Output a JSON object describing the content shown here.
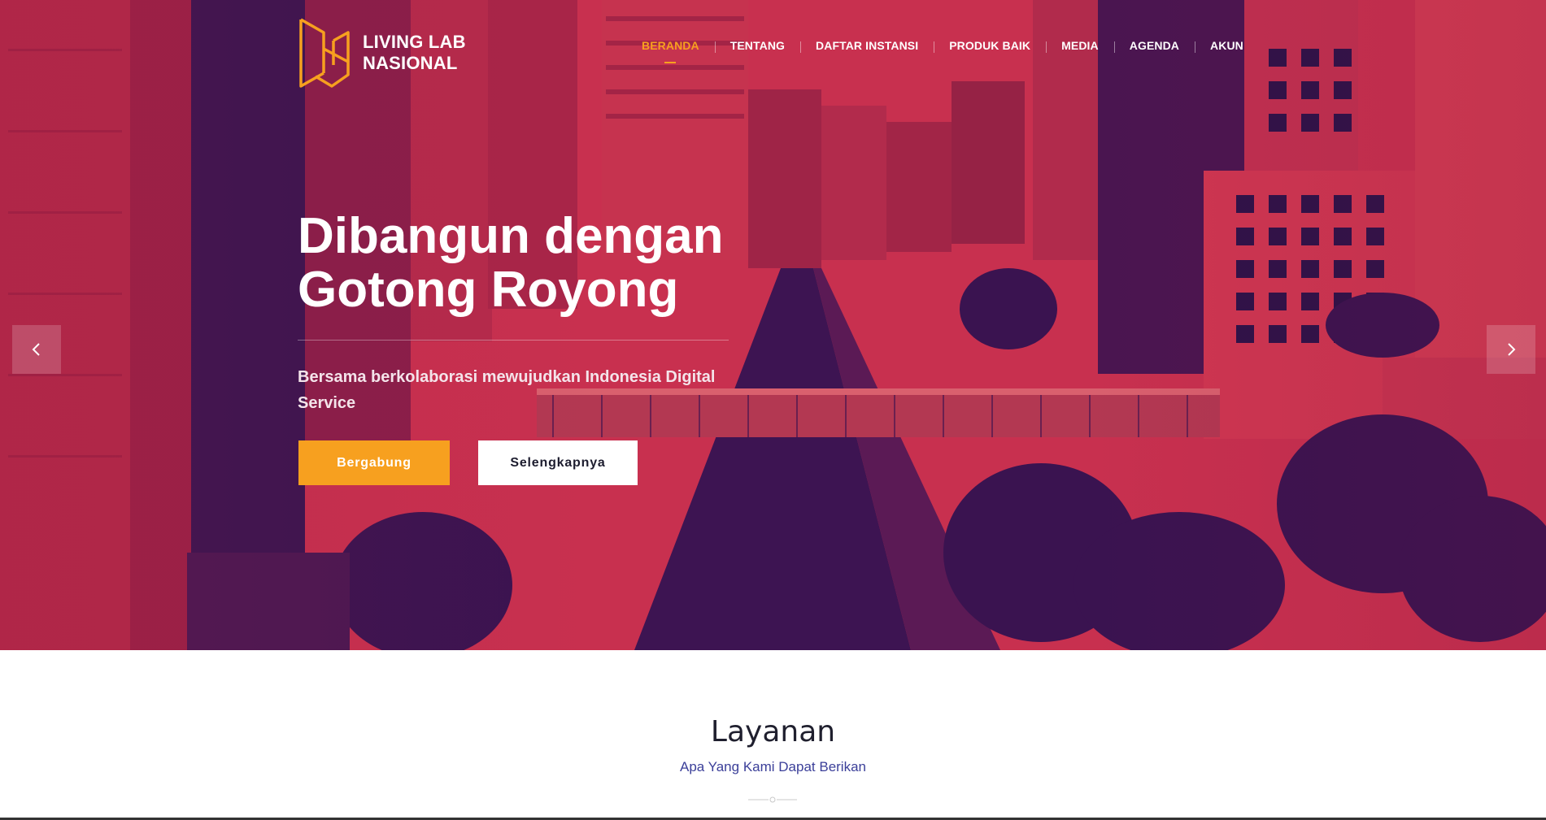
{
  "brand": {
    "line1": "LIVING LAB",
    "line2": "NASIONAL",
    "logo_icon": "living-lab-logo-icon",
    "logo_color": "#f7a01f"
  },
  "nav": {
    "items": [
      {
        "label": "BERANDA",
        "active": true
      },
      {
        "label": "TENTANG"
      },
      {
        "label": "DAFTAR INSTANSI"
      },
      {
        "label": "PRODUK BAIK"
      },
      {
        "label": "MEDIA"
      },
      {
        "label": "AGENDA"
      },
      {
        "label": "AKUN"
      }
    ],
    "active_color": "#f7a01f"
  },
  "hero": {
    "title_line1": "Dibangun dengan",
    "title_line2": "Gotong Royong",
    "subtitle": "Bersama berkolaborasi mewujudkan Indonesia Digital Service",
    "primary_button": "Bergabung",
    "secondary_button": "Selengkapnya",
    "prev_icon": "chevron-left-icon",
    "next_icon": "chevron-right-icon",
    "overlay_color": "#c92f4e"
  },
  "section": {
    "title": "Layanan",
    "subtitle": "Apa Yang Kami Dapat Berikan"
  },
  "colors": {
    "accent": "#f7a01f",
    "subtitle_blue": "#3b3f99"
  }
}
